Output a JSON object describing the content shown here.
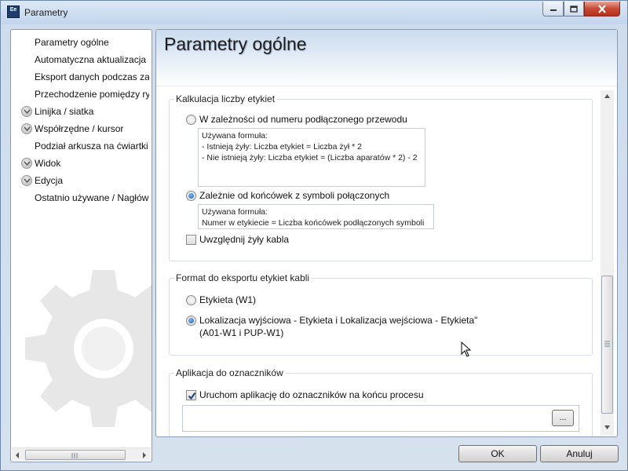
{
  "window": {
    "title": "Parametry",
    "app_icon_text": "Ee"
  },
  "nav": {
    "items": [
      {
        "label": "Parametry ogólne",
        "expander": false
      },
      {
        "label": "Automatyczna aktualizacja",
        "expander": false
      },
      {
        "label": "Eksport danych podczas zarządzania",
        "expander": false
      },
      {
        "label": "Przechodzenie pomiędzy rysunkami",
        "expander": false
      },
      {
        "label": "Linijka / siatka",
        "expander": true
      },
      {
        "label": "Współrzędne / kursor",
        "expander": true
      },
      {
        "label": "Podział arkusza na ćwiartki",
        "expander": false
      },
      {
        "label": "Widok",
        "expander": true
      },
      {
        "label": "Edycja",
        "expander": true
      },
      {
        "label": "Ostatnio używane / Nagłówki",
        "expander": false
      }
    ]
  },
  "panel": {
    "title": "Parametry ogólne",
    "label_count": {
      "title": "Kalkulacja liczby etykiet",
      "option_wire": {
        "label": "W zależności od numeru podłączonego przewodu",
        "checked": false,
        "formula": "Używana formuła:\n- Istnieją żyły: Liczba etykiet = Liczba żył * 2\n- Nie istnieją żyły: Liczba etykiet = (Liczba aparatów * 2) - 2"
      },
      "option_ends": {
        "label": "Zależnie od końcówek z symboli połączonych",
        "checked": true,
        "formula": "Używana formuła:\nNumer w etykiecie = Liczba końcówek podłączonych symboli"
      },
      "include_cores": {
        "label": "Uwzględnij żyły kabla",
        "checked": false
      }
    },
    "export_format": {
      "title": "Format do eksportu etykiet kabli",
      "option_label": {
        "label": "Etykieta (W1)",
        "checked": false
      },
      "option_location": {
        "label_line1": "Lokalizacja wyjściowa - Etykieta i Lokalizacja wejściowa - Etykieta\"",
        "label_line2": "(A01-W1 i PUP-W1)",
        "checked": true
      }
    },
    "marker_app": {
      "title": "Aplikacja do oznaczników",
      "run_app": {
        "label": "Uruchom aplikację do oznaczników na końcu procesu",
        "checked": true
      },
      "path_value": "",
      "browse_label": "..."
    }
  },
  "buttons": {
    "ok": "OK",
    "cancel": "Anuluj"
  }
}
